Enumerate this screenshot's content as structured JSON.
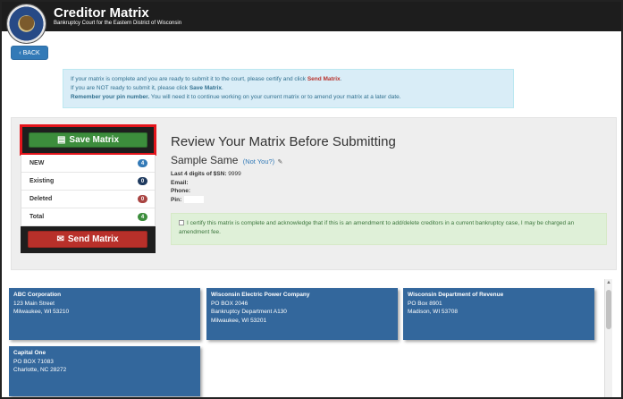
{
  "header": {
    "title": "Creditor Matrix",
    "subtitle": "Bankruptcy Court for the Eastern District of Wisconsin"
  },
  "back_button": {
    "label": "BACK",
    "icon": "chevron-left-icon"
  },
  "info_alert": {
    "line1_pre": "If your matrix is complete and you are ready to submit it to the court, please certify and click ",
    "line1_link": "Send Matrix",
    "line1_post": ".",
    "line2_pre": "If you are NOT ready to submit it, please click ",
    "line2_bold": "Save Matrix",
    "line2_post": ".",
    "line3_bold": "Remember your pin number.",
    "line3_post": " You will need it to continue working on your current matrix or to amend your matrix at a later date."
  },
  "sidebar": {
    "save_label": "Save Matrix",
    "send_label": "Send Matrix",
    "counts": [
      {
        "label": "NEW",
        "value": "4",
        "color": "#337ab7"
      },
      {
        "label": "Existing",
        "value": "0",
        "color": "#1f3a5f"
      },
      {
        "label": "Deleted",
        "value": "0",
        "color": "#a94442"
      },
      {
        "label": "Total",
        "value": "4",
        "color": "#3c8d3c"
      }
    ]
  },
  "review": {
    "title": "Review Your Matrix Before Submitting",
    "name": "Sample Same",
    "not_you": "(Not You?)",
    "ssn_label": "Last 4 digits of $SN:",
    "ssn_value": "9999",
    "email_label": "Email:",
    "phone_label": "Phone:",
    "pin_label": "Pin:"
  },
  "certify_text": "I certify this matrix is complete and acknowledge that if this is an amendment to add/delete creditors in a current bankruptcy case, I may be charged an amendment fee.",
  "creditors": [
    {
      "name": "ABC Corporation",
      "lines": [
        "123 Main Street",
        "Milwaukee, WI 53210"
      ]
    },
    {
      "name": "Wisconsin Electric Power Company",
      "lines": [
        "PO BOX 2046",
        "Bankruptcy Department A130",
        "Milwaukee, WI 53201"
      ]
    },
    {
      "name": "Wisconsin Department of Revenue",
      "lines": [
        "PO Box 8901",
        "Madison, WI 53708"
      ]
    },
    {
      "name": "Capital One",
      "lines": [
        "PO BOX 71083",
        "Charlotte, NC 28272"
      ]
    }
  ]
}
